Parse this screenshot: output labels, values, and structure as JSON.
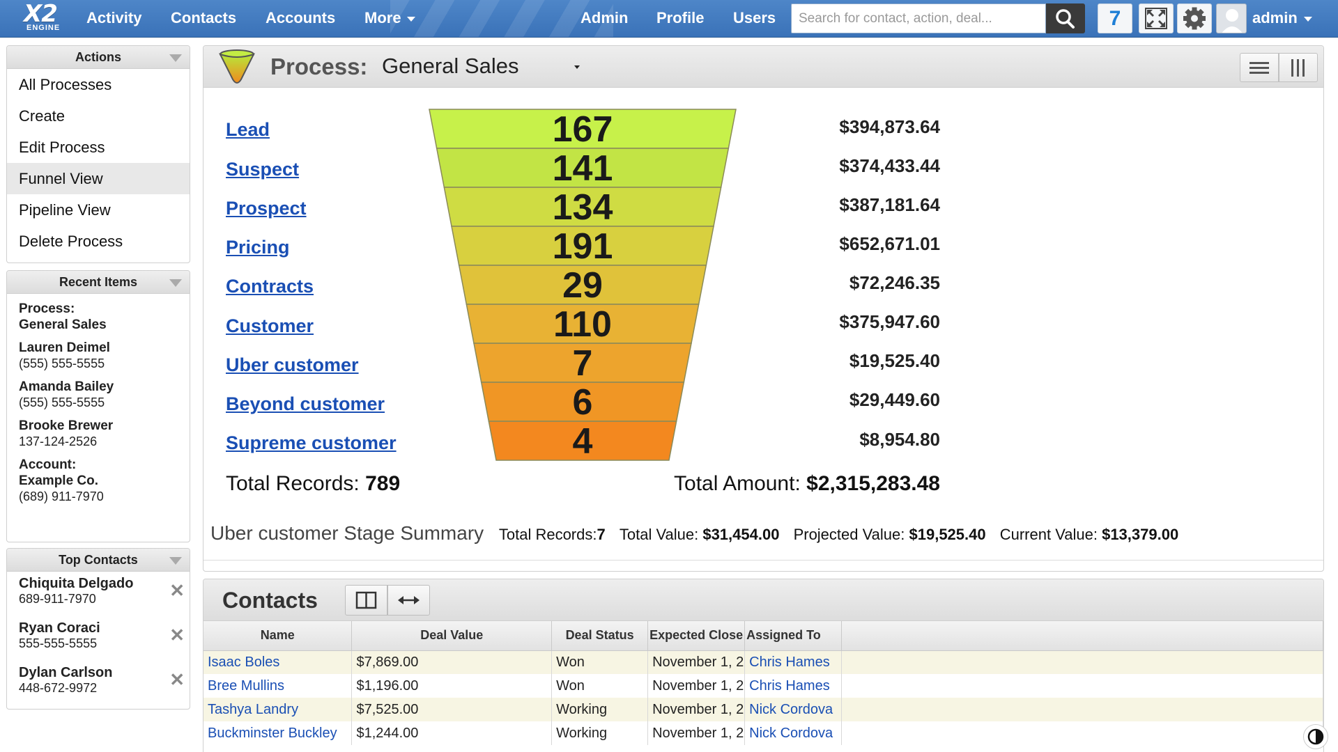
{
  "topbar": {
    "logo_main": "X2",
    "logo_sub": "ENGINE",
    "nav": [
      "Activity",
      "Contacts",
      "Accounts",
      "More"
    ],
    "right_nav": [
      "Admin",
      "Profile",
      "Users"
    ],
    "search_placeholder": "Search for contact, action, deal...",
    "notifications": "7",
    "user": "admin"
  },
  "actions": {
    "title": "Actions",
    "items": [
      "All Processes",
      "Create",
      "Edit Process",
      "Funnel View",
      "Pipeline View",
      "Delete Process"
    ],
    "selected": "Funnel View"
  },
  "recent": {
    "title": "Recent Items",
    "items": [
      {
        "l1": "Process:",
        "l2": "General Sales",
        "l3": ""
      },
      {
        "l1": "Lauren Deimel",
        "l2": "(555) 555-5555",
        "l3": ""
      },
      {
        "l1": "Amanda Bailey",
        "l2": "(555) 555-5555",
        "l3": ""
      },
      {
        "l1": "Brooke Brewer",
        "l2": "137-124-2526",
        "l3": ""
      },
      {
        "l1": "Account:",
        "l2": "Example Co.",
        "l3": "(689) 911-7970"
      }
    ]
  },
  "top_contacts": {
    "title": "Top Contacts",
    "items": [
      {
        "name": "Chiquita Delgado",
        "phone": "689-911-7970"
      },
      {
        "name": "Ryan Coraci",
        "phone": "555-555-5555"
      },
      {
        "name": "Dylan Carlson",
        "phone": "448-672-9972"
      }
    ]
  },
  "process": {
    "label": "Process:",
    "name": "General Sales",
    "stages": [
      {
        "name": "Lead",
        "count": "167",
        "amount": "$394,873.64"
      },
      {
        "name": "Suspect",
        "count": "141",
        "amount": "$374,433.44"
      },
      {
        "name": "Prospect",
        "count": "134",
        "amount": "$387,181.64"
      },
      {
        "name": "Pricing",
        "count": "191",
        "amount": "$652,671.01"
      },
      {
        "name": "Contracts",
        "count": "29",
        "amount": "$72,246.35"
      },
      {
        "name": "Customer",
        "count": "110",
        "amount": "$375,947.60"
      },
      {
        "name": "Uber customer",
        "count": "7",
        "amount": "$19,525.40"
      },
      {
        "name": "Beyond customer",
        "count": "6",
        "amount": "$29,449.60"
      },
      {
        "name": "Supreme customer",
        "count": "4",
        "amount": "$8,954.80"
      }
    ],
    "total_records_label": "Total Records:",
    "total_records": "789",
    "total_amount_label": "Total Amount:",
    "total_amount": "$2,315,283.48",
    "summary": {
      "title": "Uber customer Stage Summary",
      "records_label": "Total Records:",
      "records": "7",
      "value_label": "Total Value:",
      "value": "$31,454.00",
      "projected_label": "Projected Value:",
      "projected": "$19,525.40",
      "current_label": "Current Value:",
      "current": "$13,379.00"
    },
    "funnel_colors": [
      "#c7f14a",
      "#c2e445",
      "#cfdc43",
      "#d8d03f",
      "#e0c23a",
      "#e8b234",
      "#eda42d",
      "#f09625",
      "#f3881f"
    ]
  },
  "contacts": {
    "title": "Contacts",
    "columns": [
      "Name",
      "Deal Value",
      "Deal Status",
      "Expected Close",
      "Assigned To"
    ],
    "rows": [
      [
        "Isaac Boles",
        "$7,869.00",
        "Won",
        "November 1, 2",
        "Chris Hames"
      ],
      [
        "Bree Mullins",
        "$1,196.00",
        "Won",
        "November 1, 2",
        "Chris Hames"
      ],
      [
        "Tashya Landry",
        "$7,525.00",
        "Working",
        "November 1, 2",
        "Nick Cordova"
      ],
      [
        "Buckminster Buckley",
        "$1,244.00",
        "Working",
        "November 1, 2",
        "Nick Cordova"
      ]
    ]
  }
}
